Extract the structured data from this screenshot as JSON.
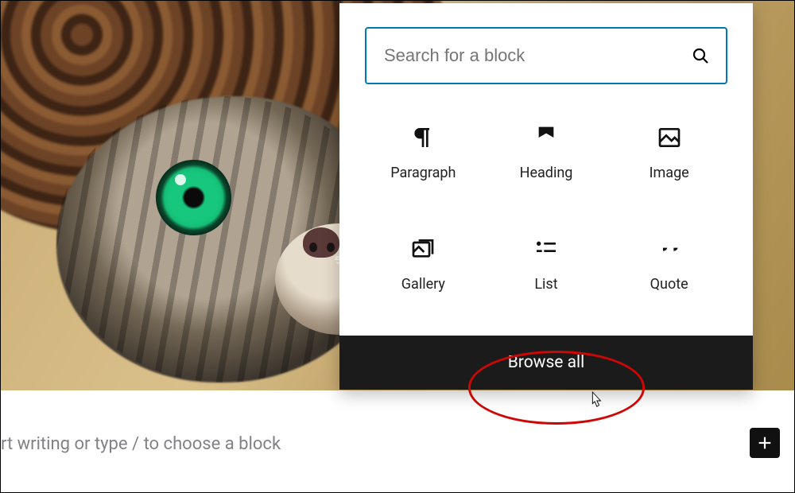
{
  "search": {
    "placeholder": "Search for a block"
  },
  "blocks": {
    "b0": "Paragraph",
    "b1": "Heading",
    "b2": "Image",
    "b3": "Gallery",
    "b4": "List",
    "b5": "Quote",
    "icons": {
      "b0": "paragraph-icon",
      "b1": "heading-icon",
      "b2": "image-icon",
      "b3": "gallery-icon",
      "b4": "list-icon",
      "b5": "quote-icon"
    }
  },
  "browse_all": "Browse all",
  "editor_placeholder": "rt writing or type / to choose a block",
  "add_button_icon": "plus-icon"
}
